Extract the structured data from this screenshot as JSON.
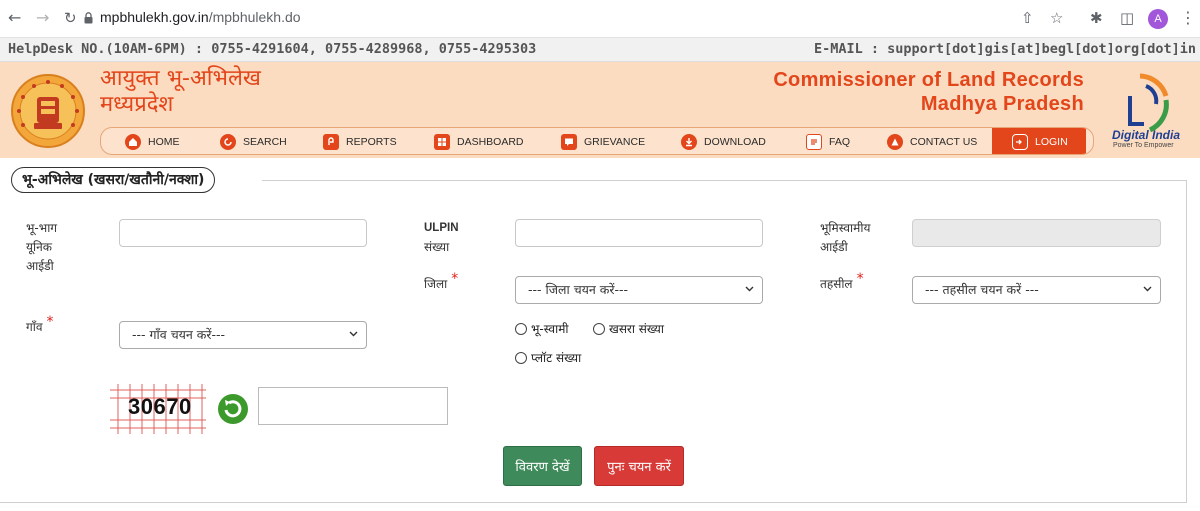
{
  "browser": {
    "url_host": "mpbhulekh.gov.in",
    "url_path": "/mpbhulekh.do",
    "profile_initial": "A"
  },
  "helpdesk": {
    "left": "HelpDesk NO.(10AM-6PM) : 0755-4291604, 0755-4289968, 0755-4295303",
    "right": "E-MAIL : support[dot]gis[at]begl[dot]org[dot]in"
  },
  "header": {
    "hindi_line1": "आयुक्त भू-अभिलेख",
    "hindi_line2": "मध्यप्रदेश",
    "english_line1": "Commissioner of Land Records",
    "english_line2": "Madhya Pradesh",
    "digital_india": "Digital India",
    "digital_india_tagline": "Power To Empower"
  },
  "menu": {
    "home": "HOME",
    "search": "SEARCH",
    "reports": "REPORTS",
    "dashboard": "DASHBOARD",
    "grievance": "GRIEVANCE",
    "download": "DOWNLOAD",
    "faq": "FAQ",
    "contact": "CONTACT US",
    "login": "LOGIN"
  },
  "form": {
    "section_title": "भू-अभिलेख (खसरा/खतौनी/नक्शा)",
    "bhubhag_label_1": "भू-भाग",
    "bhubhag_label_2": "यूनिक",
    "bhubhag_label_3": "आईडी",
    "ulpin_label_1": "ULPIN",
    "ulpin_label_2": "संख्या",
    "owner_label_1": "भूमिस्वामीय",
    "owner_label_2": "आईडी",
    "district_label": "जिला",
    "district_placeholder": "--- जिला चयन करें---",
    "tehsil_label": "तहसील",
    "tehsil_placeholder": "--- तहसील चयन करें ---",
    "village_label": "गाँव",
    "village_placeholder": "--- गाँव चयन करें---",
    "radio_owner": "भू-स्वामी",
    "radio_khasra": "खसरा संख्या",
    "radio_plot": "प्लॉट संख्या",
    "captcha_code": "30670",
    "view_button": "विवरण देखें",
    "reset_button": "पुनः चयन करें"
  },
  "colors": {
    "accent": "#e2461a",
    "header_bg": "#fcdcc1",
    "view_button": "#3f8a5a",
    "reset_button": "#d73a37"
  }
}
